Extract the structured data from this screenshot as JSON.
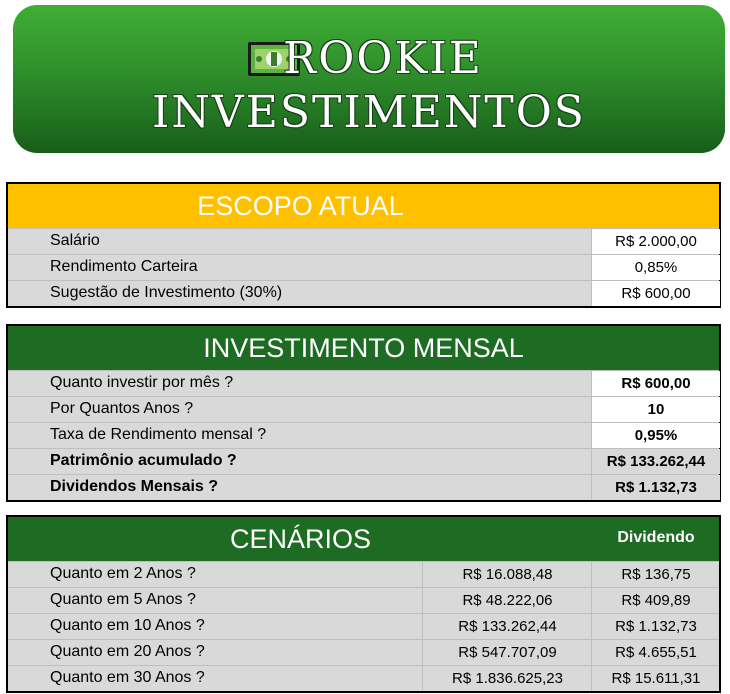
{
  "banner": {
    "line1": "ROOKIE",
    "line2": "INVESTIMENTOS",
    "icon": "money-bill-icon"
  },
  "escopo": {
    "title": "ESCOPO ATUAL",
    "rows": [
      {
        "label": "Salário",
        "value": "R$ 2.000,00"
      },
      {
        "label": "Rendimento Carteira",
        "value": "0,85%"
      },
      {
        "label": "Sugestão de Investimento (30%)",
        "value": "R$ 600,00"
      }
    ]
  },
  "mensal": {
    "title": "INVESTIMENTO MENSAL",
    "rows": [
      {
        "label": "Quanto investir por mês ?",
        "value": "R$ 600,00"
      },
      {
        "label": "Por Quantos Anos ?",
        "value": "10"
      },
      {
        "label": "Taxa de Rendimento mensal ?",
        "value": "0,95%"
      },
      {
        "label": "Patrimônio acumulado ?",
        "value": "R$ 133.262,44"
      },
      {
        "label": "Dividendos Mensais ?",
        "value": "R$ 1.132,73"
      }
    ]
  },
  "cenarios": {
    "title": "CENÁRIOS",
    "dividend_header": "Dividendo",
    "rows": [
      {
        "label": "Quanto em 2 Anos ?",
        "total": "R$ 16.088,48",
        "dividend": "R$ 136,75"
      },
      {
        "label": "Quanto em 5 Anos ?",
        "total": "R$ 48.222,06",
        "dividend": "R$ 409,89"
      },
      {
        "label": "Quanto em 10 Anos ?",
        "total": "R$ 133.262,44",
        "dividend": "R$ 1.132,73"
      },
      {
        "label": "Quanto em 20 Anos ?",
        "total": "R$ 547.707,09",
        "dividend": "R$ 4.655,51"
      },
      {
        "label": "Quanto em 30 Anos ?",
        "total": "R$ 1.836.625,23",
        "dividend": "R$ 15.611,31"
      }
    ]
  },
  "colors": {
    "gold": "#ffc000",
    "dark_green": "#1e6b24",
    "row_gray": "#d9d9d9"
  }
}
